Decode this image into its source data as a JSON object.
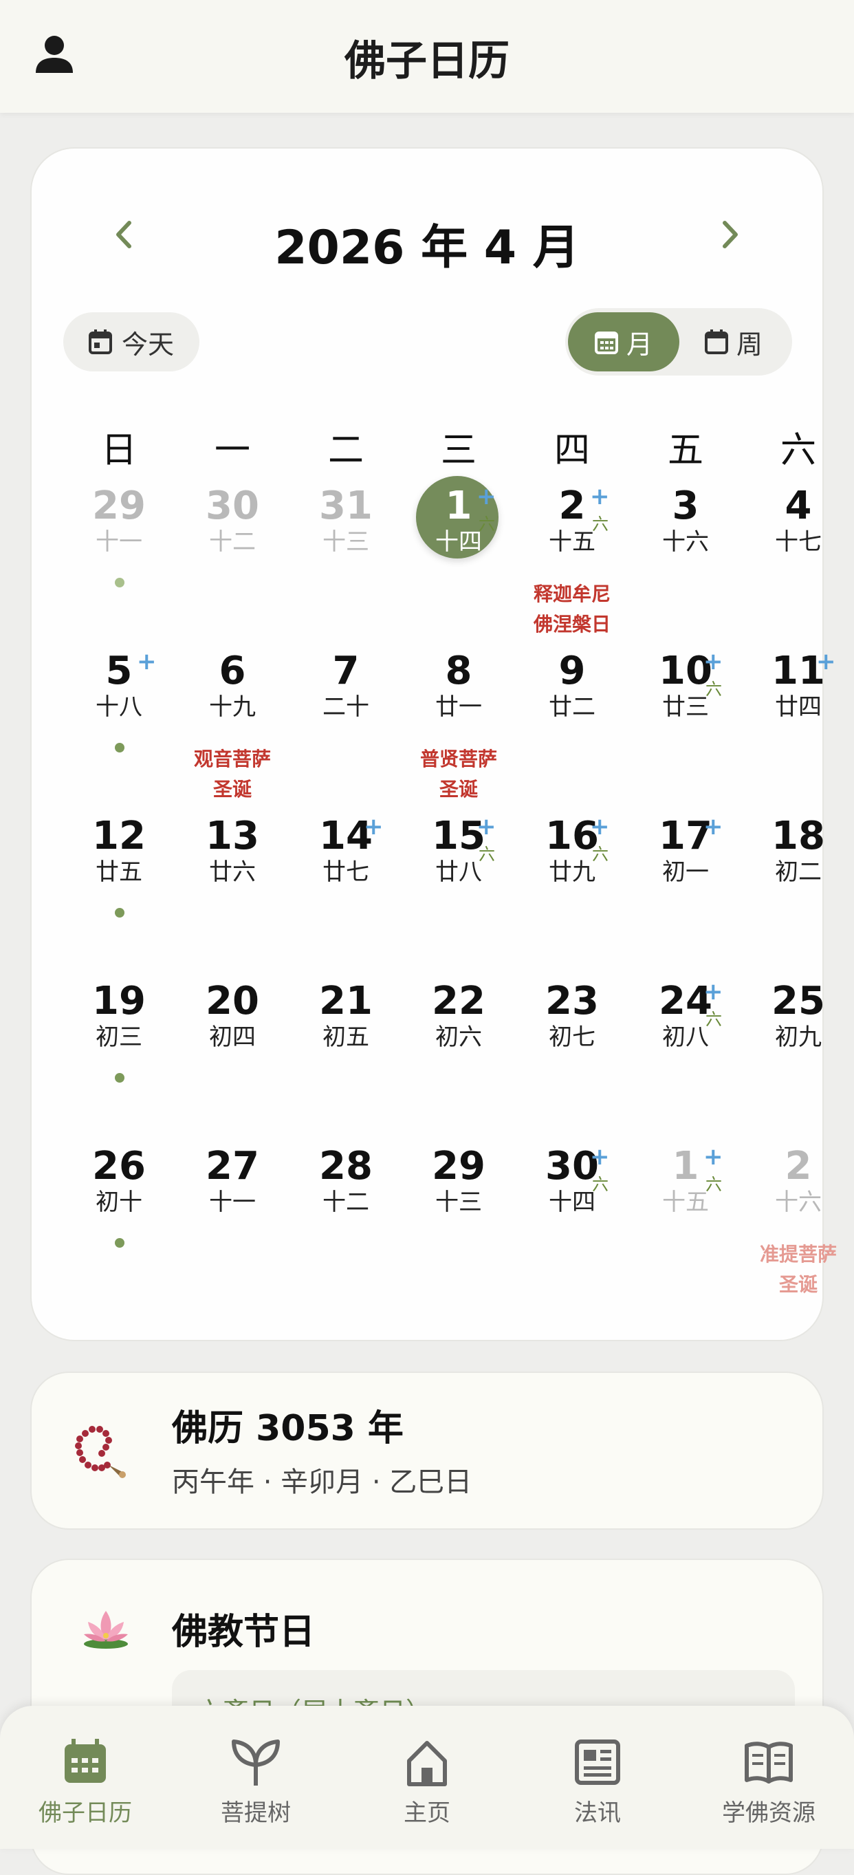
{
  "header": {
    "title": "佛子日历",
    "user_icon": "user-icon"
  },
  "calendar": {
    "month_title": "2026 年 4 月",
    "today_label": "今天",
    "view_month_label": "月",
    "view_week_label": "周",
    "weekdays": [
      "日",
      "一",
      "二",
      "三",
      "四",
      "五",
      "六"
    ],
    "accent_color": "#738a58",
    "days": [
      {
        "day": "29",
        "lunar": "十一",
        "dim": true,
        "dot": true
      },
      {
        "day": "30",
        "lunar": "十二",
        "dim": true
      },
      {
        "day": "31",
        "lunar": "十三",
        "dim": true
      },
      {
        "day": "1",
        "lunar": "十四",
        "today": true,
        "plus": true,
        "six": "六"
      },
      {
        "day": "2",
        "lunar": "十五",
        "plus": true,
        "six": "六",
        "festival": [
          "释迦牟尼",
          "佛涅槃日"
        ]
      },
      {
        "day": "3",
        "lunar": "十六"
      },
      {
        "day": "4",
        "lunar": "十七"
      },
      {
        "day": "5",
        "lunar": "十八",
        "plus": true,
        "dot": true
      },
      {
        "day": "6",
        "lunar": "十九",
        "festival": [
          "观音菩萨",
          "圣诞"
        ]
      },
      {
        "day": "7",
        "lunar": "二十"
      },
      {
        "day": "8",
        "lunar": "廿一",
        "festival": [
          "普贤菩萨",
          "圣诞"
        ]
      },
      {
        "day": "9",
        "lunar": "廿二"
      },
      {
        "day": "10",
        "lunar": "廿三",
        "plus": true,
        "six": "六"
      },
      {
        "day": "11",
        "lunar": "廿四",
        "plus": true
      },
      {
        "day": "12",
        "lunar": "廿五",
        "dot": true
      },
      {
        "day": "13",
        "lunar": "廿六"
      },
      {
        "day": "14",
        "lunar": "廿七",
        "plus": true
      },
      {
        "day": "15",
        "lunar": "廿八",
        "plus": true,
        "six": "六"
      },
      {
        "day": "16",
        "lunar": "廿九",
        "plus": true,
        "six": "六"
      },
      {
        "day": "17",
        "lunar": "初一",
        "plus": true
      },
      {
        "day": "18",
        "lunar": "初二"
      },
      {
        "day": "19",
        "lunar": "初三",
        "dot": true
      },
      {
        "day": "20",
        "lunar": "初四"
      },
      {
        "day": "21",
        "lunar": "初五"
      },
      {
        "day": "22",
        "lunar": "初六"
      },
      {
        "day": "23",
        "lunar": "初七"
      },
      {
        "day": "24",
        "lunar": "初八",
        "plus": true,
        "six": "六"
      },
      {
        "day": "25",
        "lunar": "初九"
      },
      {
        "day": "26",
        "lunar": "初十",
        "dot": true
      },
      {
        "day": "27",
        "lunar": "十一"
      },
      {
        "day": "28",
        "lunar": "十二"
      },
      {
        "day": "29",
        "lunar": "十三"
      },
      {
        "day": "30",
        "lunar": "十四",
        "plus": true,
        "six": "六"
      },
      {
        "day": "1",
        "lunar": "十五",
        "dim": true,
        "plus": true,
        "six": "六"
      },
      {
        "day": "2",
        "lunar": "十六",
        "dim": true,
        "festival": [
          "准提菩萨",
          "圣诞"
        ]
      }
    ]
  },
  "year_card": {
    "icon": "prayer-beads-icon",
    "title": "佛历 3053 年",
    "ganzhi": "丙午年 · 辛卯月 · 乙巳日"
  },
  "festival_card": {
    "icon": "lotus-icon",
    "title": "佛教节日",
    "first_item": "六斋日（居士斋日）"
  },
  "tabbar": {
    "tabs": [
      {
        "label": "佛子日历",
        "icon": "calendar-icon",
        "active": true
      },
      {
        "label": "菩提树",
        "icon": "sprout-icon"
      },
      {
        "label": "主页",
        "icon": "home-icon"
      },
      {
        "label": "法讯",
        "icon": "news-icon"
      },
      {
        "label": "学佛资源",
        "icon": "book-icon"
      }
    ]
  }
}
